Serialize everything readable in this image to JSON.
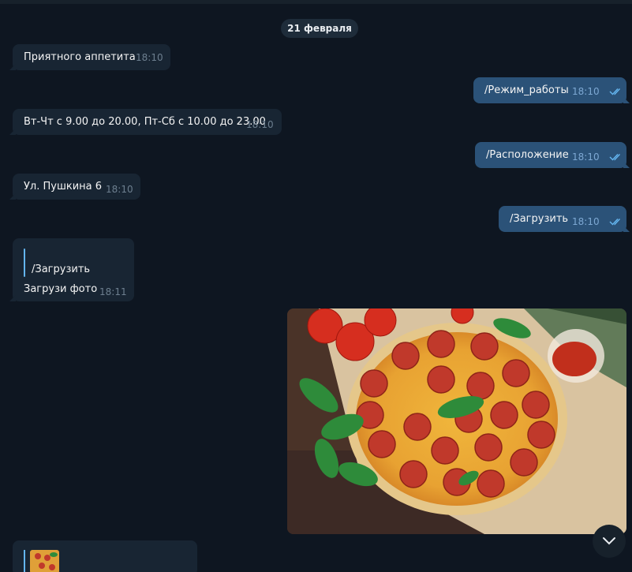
{
  "date_separator": "21 февраля",
  "messages": [
    {
      "text": "Приятного аппетита",
      "time": "18:10"
    },
    {
      "text": "/Режим_работы",
      "time": "18:10"
    },
    {
      "text": "Вт-Чт с 9.00 до 20.00, Пт-Сб с 10.00 до 23.00",
      "time": "18:10"
    },
    {
      "text": "/Расположение",
      "time": "18:10"
    },
    {
      "text": "Ул. Пушкина 6",
      "time": "18:10"
    },
    {
      "text": "/Загрузить",
      "time": "18:10"
    }
  ],
  "reply_message": {
    "quote": "/Загрузить",
    "text": "Загрузи фото",
    "time": "18:11"
  },
  "colors": {
    "background": "#0e1621",
    "incoming": "#182533",
    "outgoing": "#2b5278",
    "accent": "#64b5ef"
  },
  "icons": {
    "read_receipt": "double-check-icon",
    "scroll": "chevron-down-icon"
  }
}
